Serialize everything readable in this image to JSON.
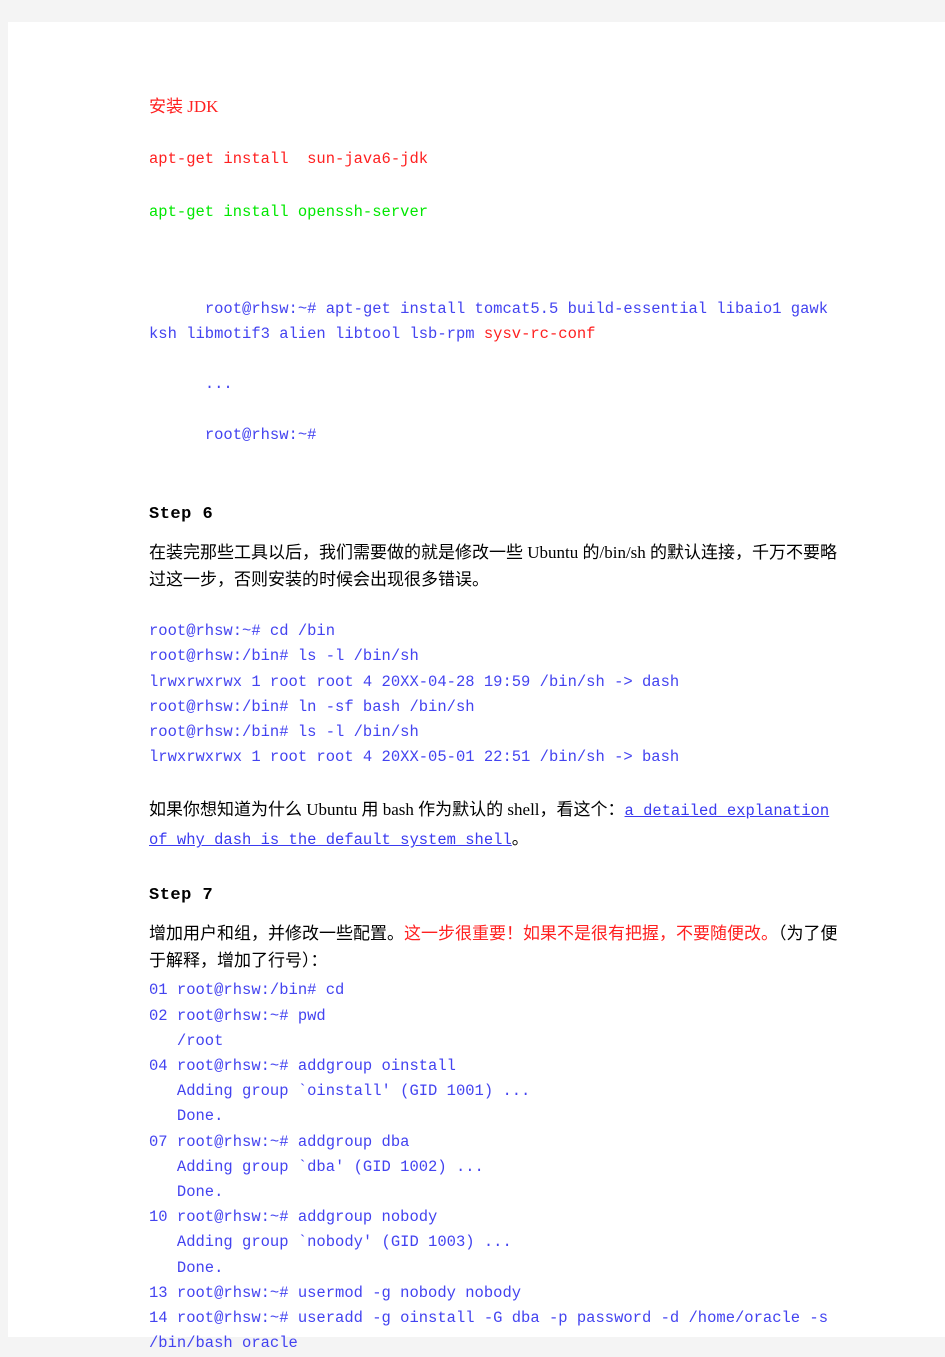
{
  "document": {
    "page_background": "#f4f4f4",
    "page_color": "#ffffff",
    "colors": {
      "red": "#ff2020",
      "green": "#00e800",
      "blue": "#4343f0",
      "black": "#000000",
      "link": "#3a3af0"
    }
  },
  "jdk_section": {
    "title": "安装 JDK",
    "command_jdk": "apt-get install  sun-java6-jdk",
    "command_ssh": "apt-get install openssh-server"
  },
  "terminal_apt": {
    "line1": "root@rhsw:~# apt-get install tomcat5.5 build-essential libaio1 gawk ksh libmotif3 alien libtool lsb-rpm ",
    "line1_highlight": "sysv-rc-conf",
    "line2": "...",
    "line3": "root@rhsw:~#"
  },
  "step6": {
    "heading": "Step 6",
    "paragraph": "在装完那些工具以后，我们需要做的就是修改一些 Ubuntu 的/bin/sh 的默认连接，千万不要略过这一步，否则安装的时候会出现很多错误。",
    "terminal": "root@rhsw:~# cd /bin\nroot@rhsw:/bin# ls -l /bin/sh\nlrwxrwxrwx 1 root root 4 20XX-04-28 19:59 /bin/sh -> dash\nroot@rhsw:/bin# ln -sf bash /bin/sh\nroot@rhsw:/bin# ls -l /bin/sh\nlrwxrwxrwx 1 root root 4 20XX-05-01 22:51 /bin/sh -> bash",
    "note_prefix": "如果你想知道为什么 Ubuntu 用 bash 作为默认的 shell，看这个：",
    "note_link": "a detailed explanation of why dash is the default system shell",
    "note_suffix": "。"
  },
  "step7": {
    "heading": "Step 7",
    "paragraph_black_1": "增加用户和组，并修改一些配置。",
    "paragraph_red": "这一步很重要！如果不是很有把握，不要随便改。",
    "paragraph_black_2": "（为了便于解释，增加了行号）：",
    "terminal": "01 root@rhsw:/bin# cd\n02 root@rhsw:~# pwd\n   /root\n04 root@rhsw:~# addgroup oinstall\n   Adding group `oinstall' (GID 1001) ...\n   Done.\n07 root@rhsw:~# addgroup dba\n   Adding group `dba' (GID 1002) ...\n   Done.\n10 root@rhsw:~# addgroup nobody\n   Adding group `nobody' (GID 1003) ...\n   Done.\n13 root@rhsw:~# usermod -g nobody nobody\n14 root@rhsw:~# useradd -g oinstall -G dba -p password -d /home/oracle -s /bin/bash oracle"
  }
}
